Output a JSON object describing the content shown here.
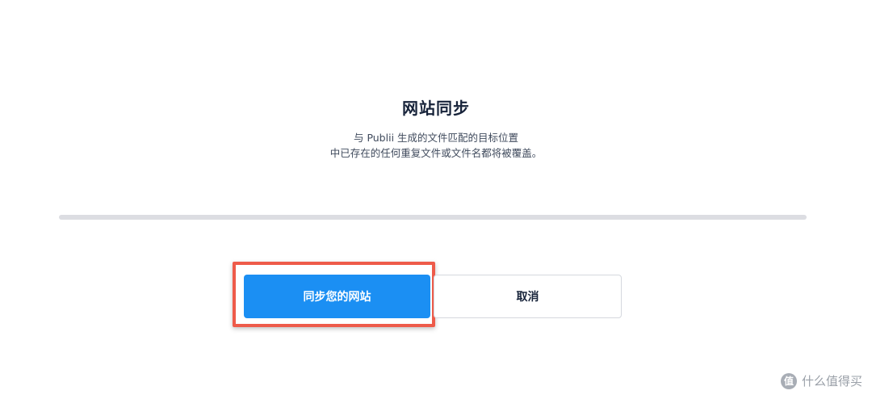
{
  "dialog": {
    "title": "网站同步",
    "description_line1": "与 Publii 生成的文件匹配的目标位置",
    "description_line2": "中已存在的任何重复文件或文件名都将被覆盖。"
  },
  "progress": {
    "value_percent": 0
  },
  "buttons": {
    "sync_label": "同步您的网站",
    "cancel_label": "取消"
  },
  "colors": {
    "primary": "#1b8ff3",
    "highlight": "#ee5b4a",
    "progress_track": "#dcdde2"
  },
  "watermark": {
    "logo_glyph": "值",
    "text": "什么值得买"
  }
}
